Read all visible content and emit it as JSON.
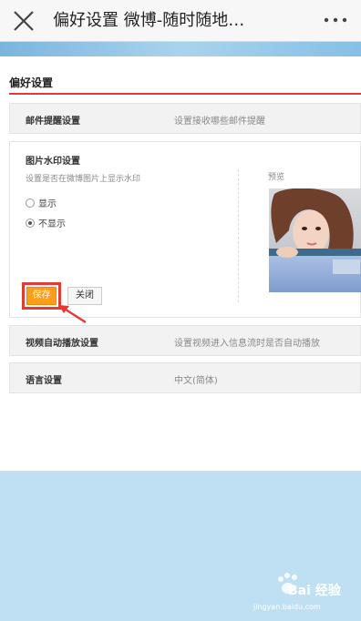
{
  "topbar": {
    "close_icon": "close-icon",
    "title": "偏好设置 微博-随时随地…",
    "more_icon": "more-dots-icon"
  },
  "page": {
    "title": "偏好设置",
    "accent_color": "#e0393e"
  },
  "rows": {
    "mail": {
      "label": "邮件提醒设置",
      "desc": "设置接收哪些邮件提醒"
    },
    "video": {
      "label": "视频自动播放设置",
      "desc": "设置视频进入信息流时是否自动播放"
    },
    "language": {
      "label": "语言设置",
      "desc": "中文(简体)"
    }
  },
  "watermark_panel": {
    "title": "图片水印设置",
    "subtitle": "设置是否在微博图片上显示水印",
    "options": [
      {
        "label": "显示",
        "selected": false
      },
      {
        "label": "不显示",
        "selected": true
      }
    ],
    "preview_label": "预览",
    "save_label": "保存",
    "close_label": "关闭",
    "save_color": "#ff9d19",
    "highlight_color": "#e53935"
  },
  "overlay": {
    "watermark_text": "Bai 经验",
    "watermark_url": "jingyan.baidu.com"
  }
}
